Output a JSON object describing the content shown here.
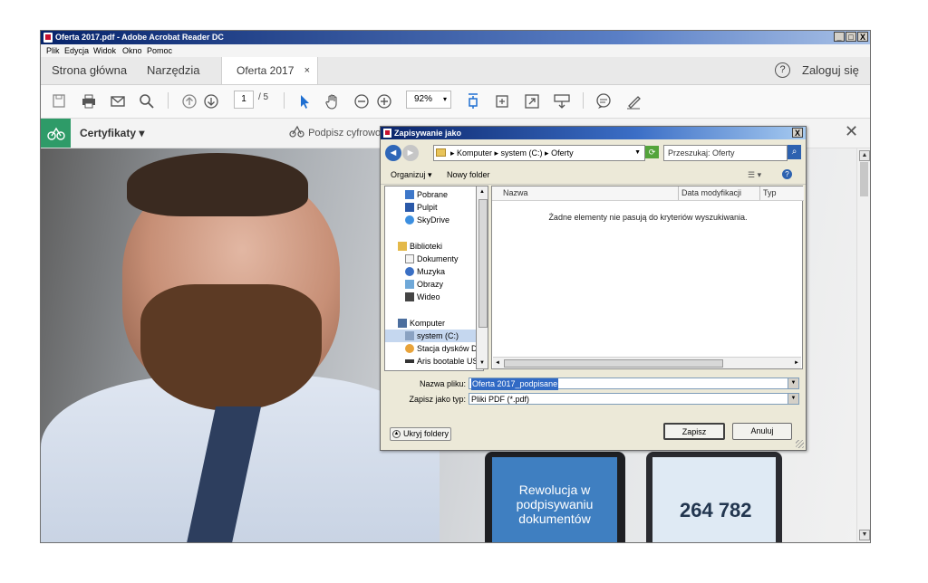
{
  "window": {
    "title": "Oferta 2017.pdf - Adobe Acrobat Reader DC",
    "controls": [
      "_",
      "□",
      "X"
    ]
  },
  "menubar": {
    "items": [
      "Plik",
      "Edycja",
      "Widok",
      "Okno",
      "Pomoc"
    ]
  },
  "tabs": {
    "home": "Strona główna",
    "tools": "Narzędzia",
    "document": "Oferta 2017",
    "close": "×",
    "help": "?",
    "login": "Zaloguj się"
  },
  "toolbar": {
    "page_current": "1",
    "page_total": "/ 5",
    "zoom": "92%",
    "zoom_arrow": "▾",
    "icons": [
      "save-icon",
      "print-icon",
      "email-icon",
      "search-icon",
      "page-up-icon",
      "page-down-icon",
      "select-arrow-icon",
      "hand-icon",
      "zoom-out-icon",
      "zoom-in-icon",
      "fit-page-icon",
      "rotate-icon",
      "fullscreen-icon",
      "scroll-mode-icon",
      "comment-icon",
      "sign-pen-icon"
    ]
  },
  "certbar": {
    "label": "Certyfikaty",
    "sign": "Podpisz cyfrowo",
    "close": "✕"
  },
  "document_content": {
    "phone1_text": "Rewolucja w podpisywaniu dokumentów",
    "phone2_number": "264 782"
  },
  "dialog": {
    "title": "Zapisywanie jako",
    "close": "X",
    "address": "▸ Komputer ▸ system (C:) ▸ Oferty",
    "search_placeholder": "Przeszukaj: Oferty",
    "organize": "Organizuj ▾",
    "new_folder": "Nowy folder",
    "nav_items": [
      {
        "label": "Pobrane",
        "icon": "downloads-icon"
      },
      {
        "label": "Pulpit",
        "icon": "desktop-icon"
      },
      {
        "label": "SkyDrive",
        "icon": "skydrive-icon"
      },
      {
        "label": "Biblioteki",
        "icon": "libraries-icon"
      },
      {
        "label": "Dokumenty",
        "icon": "documents-icon"
      },
      {
        "label": "Muzyka",
        "icon": "music-icon"
      },
      {
        "label": "Obrazy",
        "icon": "pictures-icon"
      },
      {
        "label": "Wideo",
        "icon": "video-icon"
      },
      {
        "label": "Komputer",
        "icon": "computer-icon"
      },
      {
        "label": "system (C:)",
        "icon": "drive-icon"
      },
      {
        "label": "Stacja dysków DVD",
        "icon": "dvd-icon"
      },
      {
        "label": "Aris bootable USB (",
        "icon": "usb-icon"
      }
    ],
    "columns": [
      "Nazwa",
      "Data modyfikacji",
      "Typ"
    ],
    "empty_message": "Żadne elementy nie pasują do kryteriów wyszukiwania.",
    "filename_label": "Nazwa pliku:",
    "filename_value": "Oferta 2017_podpisane",
    "filetype_label": "Zapisz jako typ:",
    "filetype_value": "Pliki PDF (*.pdf)",
    "save_button": "Zapisz",
    "cancel_button": "Anuluj",
    "hide_folders": "Ukryj foldery"
  }
}
